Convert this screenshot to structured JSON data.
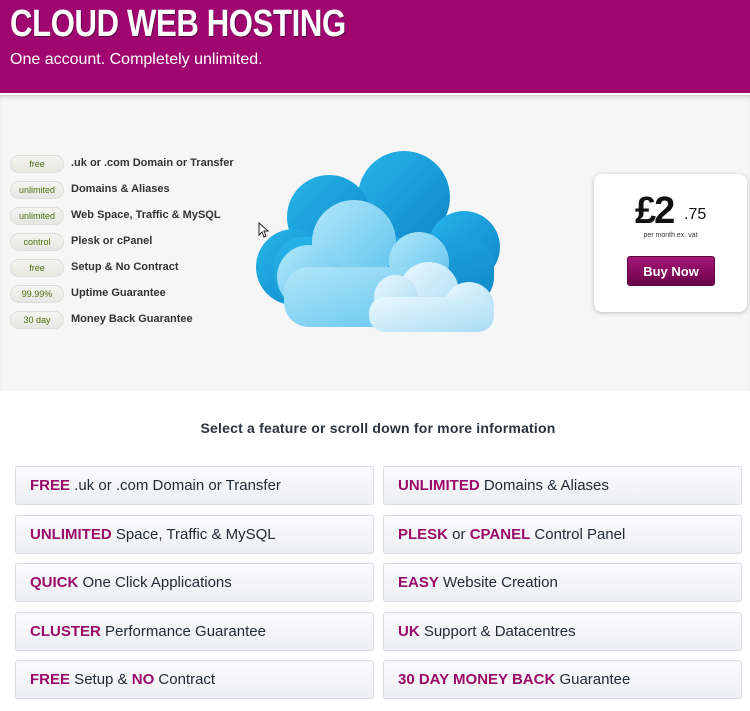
{
  "header": {
    "title": "CLOUD WEB HOSTING",
    "subtitle": "One account. Completely unlimited.",
    "brand_color": "#9f0670"
  },
  "hero_features": [
    {
      "badge": "free",
      "text": ".uk or .com Domain or Transfer"
    },
    {
      "badge": "unlimited",
      "text": "Domains & Aliases"
    },
    {
      "badge": "unlimited",
      "text": "Web Space, Traffic & MySQL"
    },
    {
      "badge": "control",
      "text": "Plesk or cPanel"
    },
    {
      "badge": "free",
      "text": "Setup & No Contract"
    },
    {
      "badge": "99.99%",
      "text": "Uptime Guarantee"
    },
    {
      "badge": "30 day",
      "text": "Money Back Guarantee"
    }
  ],
  "pricing": {
    "price_main": "£2",
    "price_pence": ".75",
    "note": "per month ex. vat",
    "buy_label": "Buy Now"
  },
  "select_heading": "Select a feature or scroll down for more information",
  "feature_cards": {
    "left": [
      [
        {
          "t": "FREE",
          "em": true
        },
        {
          "t": " .uk or .com Domain or Transfer",
          "em": false
        }
      ],
      [
        {
          "t": "UNLIMITED",
          "em": true
        },
        {
          "t": " Space, Traffic & MySQL",
          "em": false
        }
      ],
      [
        {
          "t": "QUICK",
          "em": true
        },
        {
          "t": " One Click Applications",
          "em": false
        }
      ],
      [
        {
          "t": "CLUSTER",
          "em": true
        },
        {
          "t": " Performance Guarantee",
          "em": false
        }
      ],
      [
        {
          "t": "FREE",
          "em": true
        },
        {
          "t": " Setup & ",
          "em": false
        },
        {
          "t": "NO",
          "em": true
        },
        {
          "t": " Contract",
          "em": false
        }
      ]
    ],
    "right": [
      [
        {
          "t": "UNLIMITED",
          "em": true
        },
        {
          "t": " Domains & Aliases",
          "em": false
        }
      ],
      [
        {
          "t": "PLESK",
          "em": true
        },
        {
          "t": " or ",
          "em": false
        },
        {
          "t": "CPANEL",
          "em": true
        },
        {
          "t": " Control Panel",
          "em": false
        }
      ],
      [
        {
          "t": "EASY",
          "em": true
        },
        {
          "t": " Website Creation",
          "em": false
        }
      ],
      [
        {
          "t": "UK",
          "em": true
        },
        {
          "t": " Support & Datacentres",
          "em": false
        }
      ],
      [
        {
          "t": "30 DAY MONEY BACK",
          "em": true
        },
        {
          "t": " Guarantee",
          "em": false
        }
      ]
    ]
  }
}
